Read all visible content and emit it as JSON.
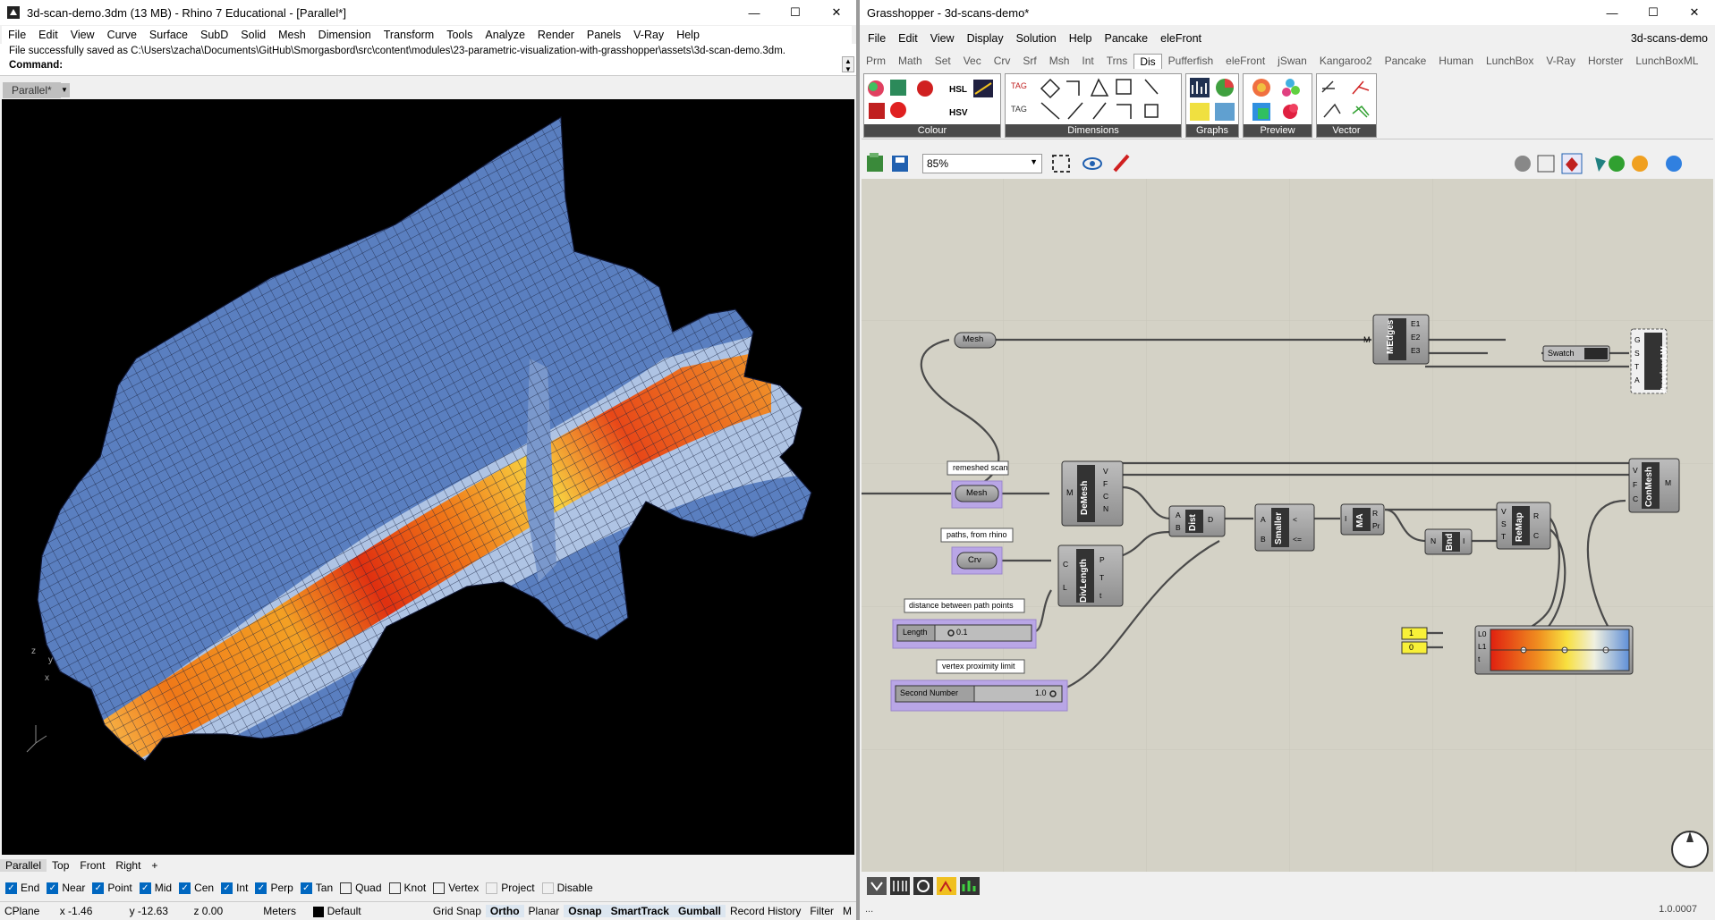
{
  "rhino": {
    "title": "3d-scan-demo.3dm (13 MB) - Rhino 7 Educational - [Parallel*]",
    "menu": [
      "File",
      "Edit",
      "View",
      "Curve",
      "Surface",
      "SubD",
      "Solid",
      "Mesh",
      "Dimension",
      "Transform",
      "Tools",
      "Analyze",
      "Render",
      "Panels",
      "V-Ray",
      "Help"
    ],
    "command_history": "File successfully saved as C:\\Users\\zacha\\Documents\\GitHub\\Smorgasbord\\src\\content\\modules\\23-parametric-visualization-with-grasshopper\\assets\\3d-scan-demo.3dm.",
    "command_label": "Command:",
    "viewport_tab": "Parallel*",
    "viewport_tabs": [
      "Parallel",
      "Top",
      "Front",
      "Right"
    ],
    "axis": {
      "z": "z",
      "y": "y",
      "x": "x"
    },
    "osnaps": [
      {
        "label": "End",
        "checked": true
      },
      {
        "label": "Near",
        "checked": true
      },
      {
        "label": "Point",
        "checked": true
      },
      {
        "label": "Mid",
        "checked": true
      },
      {
        "label": "Cen",
        "checked": true
      },
      {
        "label": "Int",
        "checked": true
      },
      {
        "label": "Perp",
        "checked": true
      },
      {
        "label": "Tan",
        "checked": true
      },
      {
        "label": "Quad",
        "checked": false
      },
      {
        "label": "Knot",
        "checked": false
      },
      {
        "label": "Vertex",
        "checked": false
      },
      {
        "label": "Project",
        "checked": false,
        "disabled": true
      },
      {
        "label": "Disable",
        "checked": false,
        "disabled": true
      }
    ],
    "status": {
      "cplane": "CPlane",
      "x": "x -1.46",
      "y": "y -12.63",
      "z": "z 0.00",
      "units": "Meters",
      "layer": "Default",
      "toggles": [
        "Grid Snap",
        "Ortho",
        "Planar",
        "Osnap",
        "SmartTrack",
        "Gumball",
        "Record History",
        "Filter"
      ],
      "active_toggles": [
        "Ortho",
        "Osnap",
        "SmartTrack",
        "Gumball"
      ],
      "trailing": "M"
    }
  },
  "grasshopper": {
    "title": "Grasshopper - 3d-scans-demo*",
    "doc_name": "3d-scans-demo",
    "menu": [
      "File",
      "Edit",
      "View",
      "Display",
      "Solution",
      "Help",
      "Pancake",
      "eleFront"
    ],
    "tabs": [
      "Prm",
      "Math",
      "Set",
      "Vec",
      "Crv",
      "Srf",
      "Msh",
      "Int",
      "Trns",
      "Dis",
      "Pufferfish",
      "eleFront",
      "jSwan",
      "Kangaroo2",
      "Pancake",
      "Human",
      "LunchBox",
      "V-Ray",
      "Horster",
      "LunchBoxML"
    ],
    "selected_tab": "Dis",
    "ribbon_groups": [
      "Colour",
      "Dimensions",
      "Graphs",
      "Preview",
      "Vector"
    ],
    "zoom": "85%",
    "version": "1.0.0007",
    "status_left": "...",
    "components": {
      "mesh_param_top": "Mesh",
      "medges": "MEdges",
      "medges_outputs": [
        "E1",
        "E2",
        "E3"
      ],
      "medges_input": "M",
      "swatch": "Swatch",
      "preview": "PreviewLW",
      "preview_inputs": [
        "G",
        "S",
        "T",
        "A"
      ],
      "group_remeshed": "remeshed scan",
      "mesh_param": "Mesh",
      "group_paths": "paths, from rhino",
      "crv_param": "Crv",
      "group_distance": "distance between path points",
      "length_slider_name": "Length",
      "length_slider_value": "0.1",
      "group_vertex": "vertex proximity limit",
      "second_slider_name": "Second Number",
      "second_slider_value": "1.0",
      "demesh": "DeMesh",
      "demesh_input": "M",
      "demesh_outputs": [
        "V",
        "F",
        "C",
        "N"
      ],
      "divlength": "DivLength",
      "divlength_inputs": [
        "C",
        "L"
      ],
      "divlength_outputs": [
        "P",
        "T",
        "t"
      ],
      "dist": "Dist",
      "dist_inputs": [
        "A",
        "B"
      ],
      "dist_output": "D",
      "smaller": "Smaller",
      "smaller_inputs": [
        "A",
        "B"
      ],
      "smaller_outputs": [
        "<",
        "<="
      ],
      "ma": "MA",
      "ma_input": "I",
      "ma_outputs": [
        "R",
        "Pr"
      ],
      "bnd": "Bnd",
      "bnd_input": "N",
      "bnd_output": "I",
      "remap": "ReMap",
      "remap_inputs": [
        "V",
        "S",
        "T"
      ],
      "remap_outputs": [
        "R",
        "C"
      ],
      "conmesh": "ConMesh",
      "conmesh_inputs": [
        "V",
        "F",
        "C"
      ],
      "conmesh_output": "M",
      "num_one": "1",
      "num_zero": "0",
      "gradient_inputs": [
        "L0",
        "L1",
        "t"
      ]
    }
  },
  "colors": {
    "mesh_blue": "#5a7fc0",
    "heat_red": "#e03010",
    "heat_orange": "#f07818",
    "heat_yellow": "#f8e040",
    "gh_canvas": "#d4d2c6",
    "gh_group": "#b9a6e6",
    "accent": "#0067c0"
  }
}
